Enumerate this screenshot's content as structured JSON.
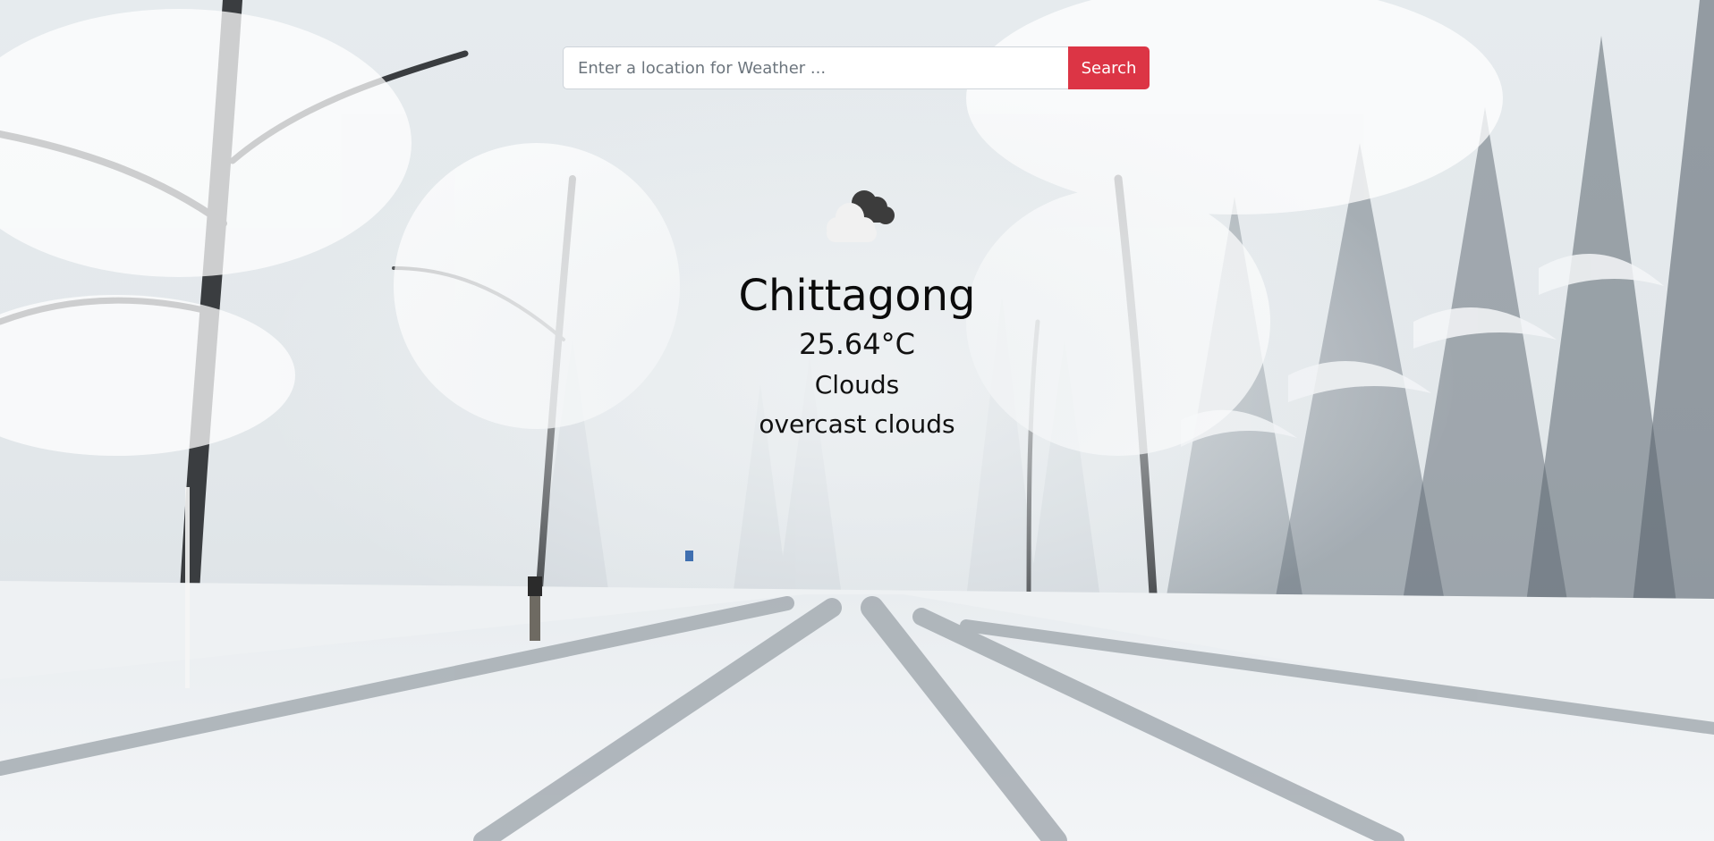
{
  "search": {
    "placeholder": "Enter a location for Weather ...",
    "value": "",
    "button_label": "Search"
  },
  "weather": {
    "icon": "overcast-clouds-icon",
    "city": "Chittagong",
    "temperature": "25.64°C",
    "main": "Clouds",
    "description": "overcast clouds"
  },
  "colors": {
    "accent": "#dc3545",
    "text": "#111111"
  }
}
